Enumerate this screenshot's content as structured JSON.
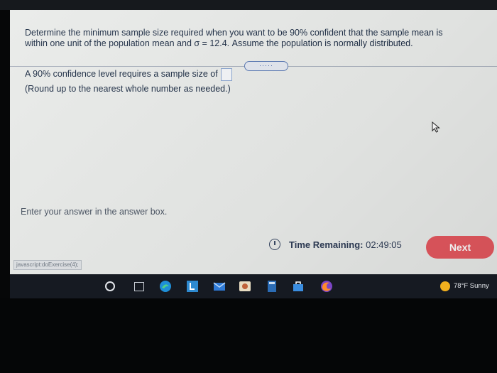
{
  "question": {
    "line1": "Determine the minimum sample size required when you want to be 90% confident that the sample mean is",
    "line2": "within one unit of the population mean and σ = 12.4. Assume the population is normally distributed."
  },
  "more_button": "·····",
  "answer": {
    "prompt": "A 90% confidence level requires a sample size of",
    "instruction": "(Round up to the nearest whole number as needed.)",
    "value": ""
  },
  "hint": "Enter your answer in the answer box.",
  "timer": {
    "label": "Time Remaining:",
    "value": "02:49:05"
  },
  "next_label": "Next",
  "status_url": "javascript:doExercise(4);",
  "taskbar": {
    "icons": [
      "start-icon",
      "task-view-icon",
      "edge-icon",
      "l-app-icon",
      "mail-icon",
      "photos-icon",
      "calculator-icon",
      "store-icon",
      "firefox-icon"
    ],
    "weather": "78°F  Sunny"
  },
  "colors": {
    "screen_bg": "#e9ebe9",
    "text": "#1c2c44",
    "next_button": "#e5585f",
    "input_border": "#8aa5cf",
    "taskbar": "#161a22"
  }
}
